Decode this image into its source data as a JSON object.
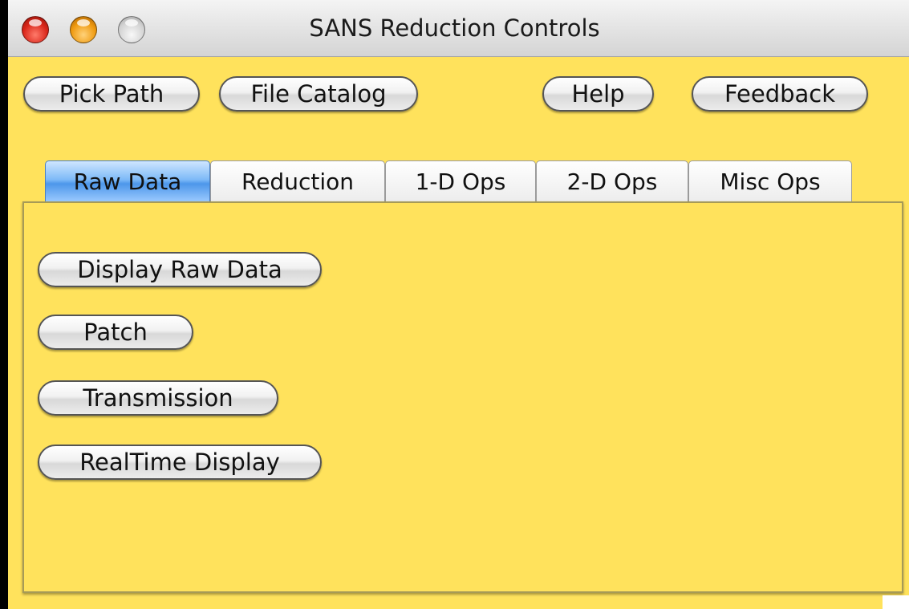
{
  "window": {
    "title": "SANS Reduction Controls"
  },
  "toolbar": {
    "pick_path": "Pick Path",
    "file_catalog": "File Catalog",
    "help": "Help",
    "feedback": "Feedback"
  },
  "tabs": [
    {
      "label": "Raw Data",
      "selected": true
    },
    {
      "label": "Reduction",
      "selected": false
    },
    {
      "label": "1-D Ops",
      "selected": false
    },
    {
      "label": "2-D Ops",
      "selected": false
    },
    {
      "label": "Misc Ops",
      "selected": false
    }
  ],
  "raw_data_panel": {
    "display_raw_data": "Display Raw Data",
    "patch": "Patch",
    "transmission": "Transmission",
    "realtime_display": "RealTime Display"
  },
  "colors": {
    "background": "#ffe25c",
    "active_tab": "#4d97ea",
    "close": "#d9261a",
    "minimize": "#ef9a10"
  }
}
